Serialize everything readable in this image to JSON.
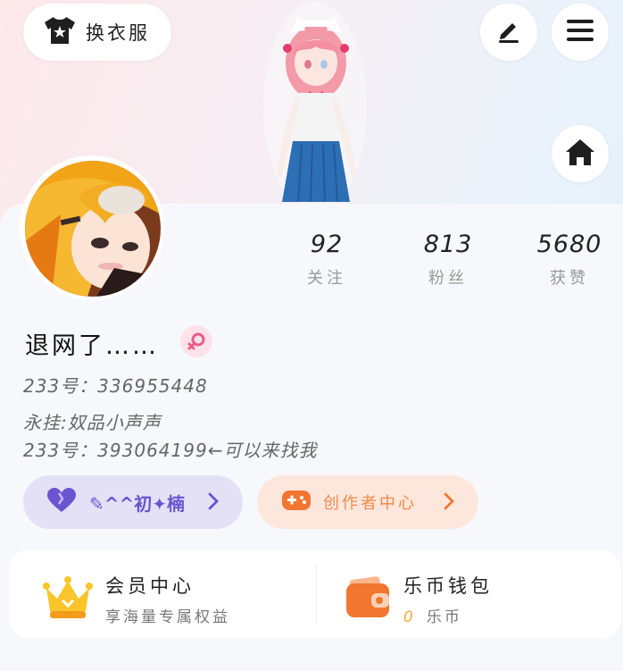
{
  "header": {
    "change_clothes_label": "换衣服",
    "icons": [
      "shirt-icon",
      "pencil-icon",
      "menu-icon",
      "home-icon"
    ]
  },
  "profile": {
    "stats": [
      {
        "value": "92",
        "label": "关注"
      },
      {
        "value": "813",
        "label": "粉丝"
      },
      {
        "value": "5680",
        "label": "获赞"
      }
    ],
    "username": "退网了……",
    "gender_icon": "female-icon",
    "id_line": "233号：336955448",
    "bio_line1": "永挂:奴品小声声",
    "bio_line2": "233号：393064199←可以来找我"
  },
  "chips": {
    "fan_chip_label": "✎^^初✦楠",
    "creator_center_label": "创作者中心"
  },
  "bottom": {
    "vip_title": "会员中心",
    "vip_sub": "享海量专属权益",
    "wallet_title": "乐币钱包",
    "wallet_value": "0",
    "wallet_unit": "乐币"
  },
  "colors": {
    "accent_purple": "#6a54d0",
    "accent_orange": "#f08a4b",
    "coin_yellow": "#f5a83a",
    "gender_pink": "#e85d8a"
  }
}
